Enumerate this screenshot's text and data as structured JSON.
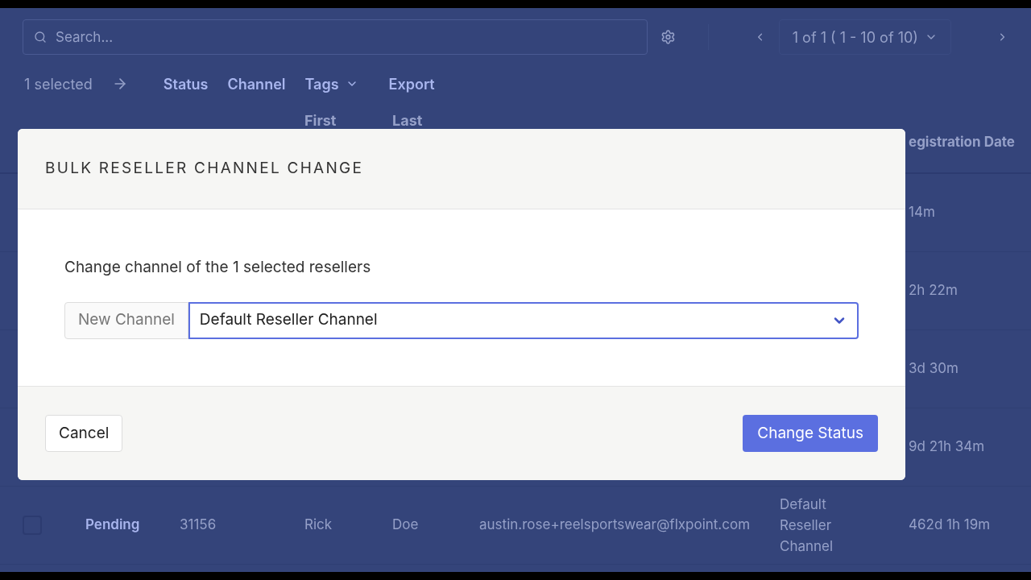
{
  "toolbar": {
    "search": {
      "placeholder": "Search..."
    },
    "pager": "1 of 1 ( 1 - 10 of 10)"
  },
  "bulk_bar": {
    "selected": "1 selected",
    "actions": [
      {
        "label": "Status",
        "dropdown": false
      },
      {
        "label": "Channel",
        "dropdown": false
      },
      {
        "label": "Tags",
        "dropdown": true
      },
      {
        "label": "Export",
        "dropdown": false
      }
    ]
  },
  "table": {
    "header": {
      "first": "First",
      "last": "Last",
      "registration_date": "egistration Date"
    },
    "rows": [
      {
        "registration": "14m"
      },
      {
        "registration": "2h 22m"
      },
      {
        "registration": "3d 30m"
      },
      {
        "registration": "9d 21h 34m"
      },
      {
        "checked": false,
        "status": "Pending",
        "id": "31156",
        "first": "Rick",
        "last": "Doe",
        "email": "austin.rose+reelsportswear@flxpoint.com",
        "channel": "Default Reseller Channel",
        "registration": "462d 1h 19m"
      }
    ]
  },
  "modal": {
    "title": "BULK RESELLER CHANNEL CHANGE",
    "message": "Change channel of the 1 selected resellers",
    "field_label": "New Channel",
    "select_value": "Default Reseller Channel",
    "cancel": "Cancel",
    "confirm": "Change Status"
  }
}
